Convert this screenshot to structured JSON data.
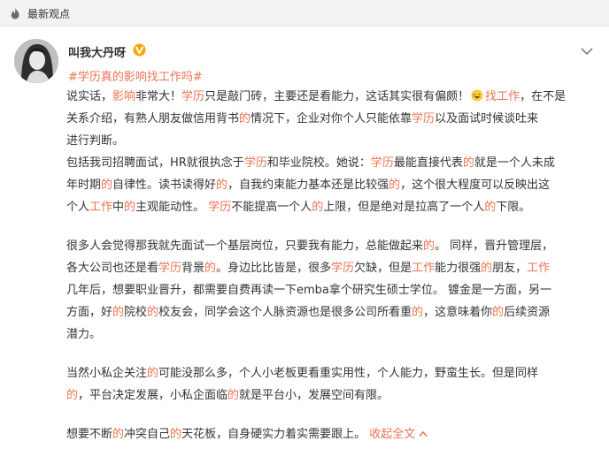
{
  "section": {
    "title": "最新观点"
  },
  "post": {
    "username": "叫我大丹呀",
    "topic": "#学历真的影响找工作吗#",
    "link_text": "找工作",
    "collapse_label": "收起全文",
    "lines": [
      [
        [
          "说实话，"
        ],
        [
          "影响",
          "h"
        ],
        [
          "非常大！"
        ],
        [
          "学历",
          "h"
        ],
        [
          "只是敲门砖，主要还是看能力，这话其实很有偏颇！"
        ]
      ],
      [
        [
          "关系介绍，有熟人朋友做信用背书"
        ],
        [
          "的",
          "h"
        ],
        [
          "情况下，企业对你个人只能依靠"
        ],
        [
          "学历",
          "h"
        ],
        [
          "以及面试时候谈吐来"
        ]
      ],
      [
        [
          "进行判断。"
        ]
      ],
      [
        [
          "包括我司招聘面试，HR就很执念于"
        ],
        [
          "学历",
          "h"
        ],
        [
          "和毕业院校。她说："
        ],
        [
          "学历",
          "h"
        ],
        [
          "最能直接代表"
        ],
        [
          "的",
          "h"
        ],
        [
          "就是一个人未成"
        ]
      ],
      [
        [
          "年时期"
        ],
        [
          "的",
          "h"
        ],
        [
          "自律性。读书读得好"
        ],
        [
          "的",
          "h"
        ],
        [
          "，自我约束能力基本还是比较强"
        ],
        [
          "的",
          "h"
        ],
        [
          "，这个很大程度可以反映出这"
        ]
      ],
      [
        [
          "个人"
        ],
        [
          "工作",
          "h"
        ],
        [
          "中"
        ],
        [
          "的",
          "h"
        ],
        [
          "主观能动性。 "
        ],
        [
          "学历",
          "h"
        ],
        [
          "不能提高一个人"
        ],
        [
          "的",
          "h"
        ],
        [
          "上限，但是绝对是拉高了一个人"
        ],
        [
          "的",
          "h"
        ],
        [
          "下限。"
        ]
      ],
      [
        [
          "很多人会觉得那我就先面试一个基层岗位，只要我有能力，总能做起来"
        ],
        [
          "的",
          "h"
        ],
        [
          "。 同样，晋升管理层，"
        ]
      ],
      [
        [
          "各大公司也还是看"
        ],
        [
          "学历",
          "h"
        ],
        [
          "背景"
        ],
        [
          "的",
          "h"
        ],
        [
          "。身边比比皆是，很多"
        ],
        [
          "学历",
          "h"
        ],
        [
          "欠缺，但是"
        ],
        [
          "工作",
          "h"
        ],
        [
          "能力很强"
        ],
        [
          "的",
          "h"
        ],
        [
          "朋友，"
        ],
        [
          "工作",
          "h"
        ]
      ],
      [
        [
          "几年后，想要职业晋升，都需要自费再读一下emba拿个研究生硕士学位。 镀金是一方面，另一"
        ]
      ],
      [
        [
          "方面，好"
        ],
        [
          "的",
          "h"
        ],
        [
          "院校"
        ],
        [
          "的",
          "h"
        ],
        [
          "校友会，同学会这个人脉资源也是很多公司所看重"
        ],
        [
          "的",
          "h"
        ],
        [
          "，这意味着你"
        ],
        [
          "的",
          "h"
        ],
        [
          "后续资源"
        ]
      ],
      [
        [
          "潜力。"
        ]
      ],
      [
        [
          "当然小私企关注"
        ],
        [
          "的",
          "h"
        ],
        [
          "可能没那么多，个人小老板更看重实用性，个人能力，野蛮生长。但是同样"
        ]
      ],
      [
        [
          "的",
          "h"
        ],
        [
          "，平台决定发展，小私企面临"
        ],
        [
          "的",
          "h"
        ],
        [
          "就是平台小，发展空间有限。"
        ]
      ],
      [
        [
          "想要不断"
        ],
        [
          "的",
          "h"
        ],
        [
          "冲突自己"
        ],
        [
          "的",
          "h"
        ],
        [
          "天花板，自身硬实力着实需要跟上。 "
        ]
      ]
    ],
    "line_one_tail": "，在不是"
  },
  "colors": {
    "accent": "#eb7350",
    "text": "#333333",
    "header_bg": "#f2f2f2"
  },
  "icons": {
    "section": "fire-icon",
    "verified": "verified-badge-icon",
    "more": "chevron-down-icon",
    "emoji": "laughing-emoji-icon"
  }
}
